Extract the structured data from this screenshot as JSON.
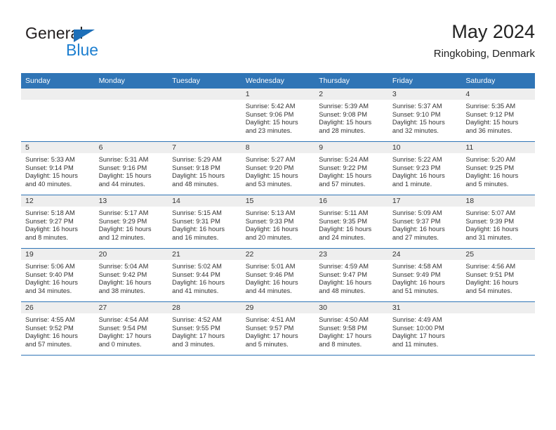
{
  "brand": {
    "name_top": "General",
    "name_bottom": "Blue",
    "color_dark": "#231f20",
    "color_blue": "#1d7fd0",
    "triangle_color": "#1d6fb8"
  },
  "header": {
    "title": "May 2024",
    "subtitle": "Ringkobing, Denmark"
  },
  "theme": {
    "header_bg": "#3075b6",
    "daynum_bg": "#eeeeee",
    "row_divider": "#3075b6",
    "text": "#333333"
  },
  "weekdays": [
    "Sunday",
    "Monday",
    "Tuesday",
    "Wednesday",
    "Thursday",
    "Friday",
    "Saturday"
  ],
  "weeks": [
    [
      {
        "day": "",
        "sunrise": "",
        "sunset": "",
        "daylight_line1": "",
        "daylight_line2": ""
      },
      {
        "day": "",
        "sunrise": "",
        "sunset": "",
        "daylight_line1": "",
        "daylight_line2": ""
      },
      {
        "day": "",
        "sunrise": "",
        "sunset": "",
        "daylight_line1": "",
        "daylight_line2": ""
      },
      {
        "day": "1",
        "sunrise": "Sunrise: 5:42 AM",
        "sunset": "Sunset: 9:06 PM",
        "daylight_line1": "Daylight: 15 hours",
        "daylight_line2": "and 23 minutes."
      },
      {
        "day": "2",
        "sunrise": "Sunrise: 5:39 AM",
        "sunset": "Sunset: 9:08 PM",
        "daylight_line1": "Daylight: 15 hours",
        "daylight_line2": "and 28 minutes."
      },
      {
        "day": "3",
        "sunrise": "Sunrise: 5:37 AM",
        "sunset": "Sunset: 9:10 PM",
        "daylight_line1": "Daylight: 15 hours",
        "daylight_line2": "and 32 minutes."
      },
      {
        "day": "4",
        "sunrise": "Sunrise: 5:35 AM",
        "sunset": "Sunset: 9:12 PM",
        "daylight_line1": "Daylight: 15 hours",
        "daylight_line2": "and 36 minutes."
      }
    ],
    [
      {
        "day": "5",
        "sunrise": "Sunrise: 5:33 AM",
        "sunset": "Sunset: 9:14 PM",
        "daylight_line1": "Daylight: 15 hours",
        "daylight_line2": "and 40 minutes."
      },
      {
        "day": "6",
        "sunrise": "Sunrise: 5:31 AM",
        "sunset": "Sunset: 9:16 PM",
        "daylight_line1": "Daylight: 15 hours",
        "daylight_line2": "and 44 minutes."
      },
      {
        "day": "7",
        "sunrise": "Sunrise: 5:29 AM",
        "sunset": "Sunset: 9:18 PM",
        "daylight_line1": "Daylight: 15 hours",
        "daylight_line2": "and 48 minutes."
      },
      {
        "day": "8",
        "sunrise": "Sunrise: 5:27 AM",
        "sunset": "Sunset: 9:20 PM",
        "daylight_line1": "Daylight: 15 hours",
        "daylight_line2": "and 53 minutes."
      },
      {
        "day": "9",
        "sunrise": "Sunrise: 5:24 AM",
        "sunset": "Sunset: 9:22 PM",
        "daylight_line1": "Daylight: 15 hours",
        "daylight_line2": "and 57 minutes."
      },
      {
        "day": "10",
        "sunrise": "Sunrise: 5:22 AM",
        "sunset": "Sunset: 9:23 PM",
        "daylight_line1": "Daylight: 16 hours",
        "daylight_line2": "and 1 minute."
      },
      {
        "day": "11",
        "sunrise": "Sunrise: 5:20 AM",
        "sunset": "Sunset: 9:25 PM",
        "daylight_line1": "Daylight: 16 hours",
        "daylight_line2": "and 5 minutes."
      }
    ],
    [
      {
        "day": "12",
        "sunrise": "Sunrise: 5:18 AM",
        "sunset": "Sunset: 9:27 PM",
        "daylight_line1": "Daylight: 16 hours",
        "daylight_line2": "and 8 minutes."
      },
      {
        "day": "13",
        "sunrise": "Sunrise: 5:17 AM",
        "sunset": "Sunset: 9:29 PM",
        "daylight_line1": "Daylight: 16 hours",
        "daylight_line2": "and 12 minutes."
      },
      {
        "day": "14",
        "sunrise": "Sunrise: 5:15 AM",
        "sunset": "Sunset: 9:31 PM",
        "daylight_line1": "Daylight: 16 hours",
        "daylight_line2": "and 16 minutes."
      },
      {
        "day": "15",
        "sunrise": "Sunrise: 5:13 AM",
        "sunset": "Sunset: 9:33 PM",
        "daylight_line1": "Daylight: 16 hours",
        "daylight_line2": "and 20 minutes."
      },
      {
        "day": "16",
        "sunrise": "Sunrise: 5:11 AM",
        "sunset": "Sunset: 9:35 PM",
        "daylight_line1": "Daylight: 16 hours",
        "daylight_line2": "and 24 minutes."
      },
      {
        "day": "17",
        "sunrise": "Sunrise: 5:09 AM",
        "sunset": "Sunset: 9:37 PM",
        "daylight_line1": "Daylight: 16 hours",
        "daylight_line2": "and 27 minutes."
      },
      {
        "day": "18",
        "sunrise": "Sunrise: 5:07 AM",
        "sunset": "Sunset: 9:39 PM",
        "daylight_line1": "Daylight: 16 hours",
        "daylight_line2": "and 31 minutes."
      }
    ],
    [
      {
        "day": "19",
        "sunrise": "Sunrise: 5:06 AM",
        "sunset": "Sunset: 9:40 PM",
        "daylight_line1": "Daylight: 16 hours",
        "daylight_line2": "and 34 minutes."
      },
      {
        "day": "20",
        "sunrise": "Sunrise: 5:04 AM",
        "sunset": "Sunset: 9:42 PM",
        "daylight_line1": "Daylight: 16 hours",
        "daylight_line2": "and 38 minutes."
      },
      {
        "day": "21",
        "sunrise": "Sunrise: 5:02 AM",
        "sunset": "Sunset: 9:44 PM",
        "daylight_line1": "Daylight: 16 hours",
        "daylight_line2": "and 41 minutes."
      },
      {
        "day": "22",
        "sunrise": "Sunrise: 5:01 AM",
        "sunset": "Sunset: 9:46 PM",
        "daylight_line1": "Daylight: 16 hours",
        "daylight_line2": "and 44 minutes."
      },
      {
        "day": "23",
        "sunrise": "Sunrise: 4:59 AM",
        "sunset": "Sunset: 9:47 PM",
        "daylight_line1": "Daylight: 16 hours",
        "daylight_line2": "and 48 minutes."
      },
      {
        "day": "24",
        "sunrise": "Sunrise: 4:58 AM",
        "sunset": "Sunset: 9:49 PM",
        "daylight_line1": "Daylight: 16 hours",
        "daylight_line2": "and 51 minutes."
      },
      {
        "day": "25",
        "sunrise": "Sunrise: 4:56 AM",
        "sunset": "Sunset: 9:51 PM",
        "daylight_line1": "Daylight: 16 hours",
        "daylight_line2": "and 54 minutes."
      }
    ],
    [
      {
        "day": "26",
        "sunrise": "Sunrise: 4:55 AM",
        "sunset": "Sunset: 9:52 PM",
        "daylight_line1": "Daylight: 16 hours",
        "daylight_line2": "and 57 minutes."
      },
      {
        "day": "27",
        "sunrise": "Sunrise: 4:54 AM",
        "sunset": "Sunset: 9:54 PM",
        "daylight_line1": "Daylight: 17 hours",
        "daylight_line2": "and 0 minutes."
      },
      {
        "day": "28",
        "sunrise": "Sunrise: 4:52 AM",
        "sunset": "Sunset: 9:55 PM",
        "daylight_line1": "Daylight: 17 hours",
        "daylight_line2": "and 3 minutes."
      },
      {
        "day": "29",
        "sunrise": "Sunrise: 4:51 AM",
        "sunset": "Sunset: 9:57 PM",
        "daylight_line1": "Daylight: 17 hours",
        "daylight_line2": "and 5 minutes."
      },
      {
        "day": "30",
        "sunrise": "Sunrise: 4:50 AM",
        "sunset": "Sunset: 9:58 PM",
        "daylight_line1": "Daylight: 17 hours",
        "daylight_line2": "and 8 minutes."
      },
      {
        "day": "31",
        "sunrise": "Sunrise: 4:49 AM",
        "sunset": "Sunset: 10:00 PM",
        "daylight_line1": "Daylight: 17 hours",
        "daylight_line2": "and 11 minutes."
      },
      {
        "day": "",
        "sunrise": "",
        "sunset": "",
        "daylight_line1": "",
        "daylight_line2": ""
      }
    ]
  ]
}
